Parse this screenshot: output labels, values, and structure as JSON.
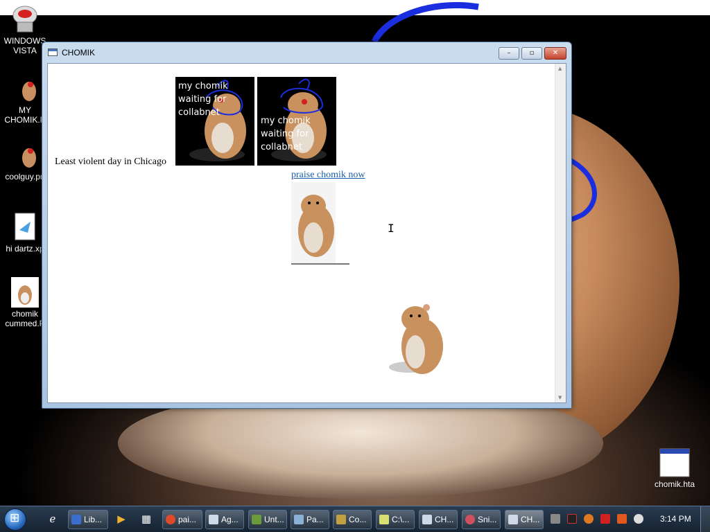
{
  "desktop": {
    "icons": [
      {
        "label": "WINDOWS\nVISTA",
        "icon": "vista-logo-icon"
      },
      {
        "label": "MY\nCHOMIK.P",
        "icon": "image-file-icon"
      },
      {
        "label": "coolguy.pn",
        "icon": "image-file-icon"
      },
      {
        "label": "hi dartz.xp",
        "icon": "document-file-icon"
      },
      {
        "label": "chomik\ncummed.P",
        "icon": "image-file-icon"
      },
      {
        "label": "chomik.hta",
        "icon": "hta-file-icon"
      }
    ]
  },
  "window": {
    "title": "CHOMIK",
    "buttons": {
      "minimize": "–",
      "maximize": "▫",
      "close": "✕"
    },
    "content": {
      "caption": "Least violent day in Chicago",
      "image1_text": "my chomik\nwaiting for\ncollabnet",
      "image2_text": "my chomik\nwaiting for\ncollabnet",
      "link_text": "praise chomik now"
    }
  },
  "taskbar": {
    "items": [
      {
        "label": "Lib...",
        "color": "#3a6fd0"
      },
      {
        "label": "pai...",
        "color": "#e04a2a"
      },
      {
        "label": "Ag...",
        "color": "#cfd8e6"
      },
      {
        "label": "Unt...",
        "color": "#6a9a3a"
      },
      {
        "label": "Pa...",
        "color": "#8ab0d8"
      },
      {
        "label": "Co...",
        "color": "#c0a040"
      },
      {
        "label": "C:\\...",
        "color": "#d8e070"
      },
      {
        "label": "CH...",
        "color": "#cfd8e6"
      },
      {
        "label": "Sni...",
        "color": "#d05060"
      },
      {
        "label": "CH...",
        "color": "#cfd8e6"
      }
    ],
    "clock": "3:14 PM"
  }
}
